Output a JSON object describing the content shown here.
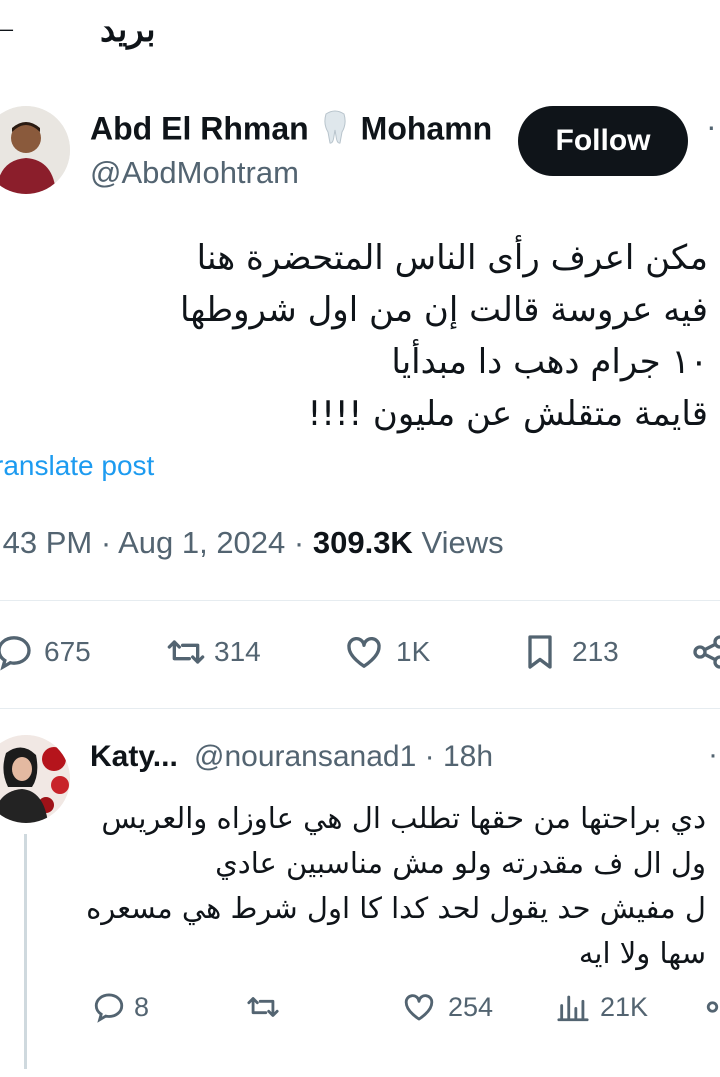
{
  "header": {
    "back_icon": "back-arrow-icon",
    "title": "بريد"
  },
  "tweet": {
    "author_name": "Abd El Rhman",
    "author_name_suffix": "Mohamn",
    "author_emoji": "tooth-icon",
    "handle": "@AbdMohtram",
    "follow_label": "Follow",
    "more_label": "·",
    "lines": [
      "مكن اعرف رأى الناس المتحضرة هنا",
      "فيه عروسة قالت إن من اول شروطها",
      "١٠ جرام دهب دا مبدأيا",
      "قايمة متقلش عن مليون !!!!"
    ],
    "translate_label": "ranslate post",
    "time": ":43 PM",
    "date": "Aug 1, 2024",
    "separator": "·",
    "views_count": "309.3K",
    "views_label": "Views",
    "replies": "675",
    "reposts": "314",
    "likes": "1K",
    "bookmarks": "213"
  },
  "reply": {
    "author_name": "Katy...",
    "handle": "@nouransanad1",
    "time": "· 18h",
    "more_label": "·",
    "lines": [
      "دي براحتها من حقها تطلب ال هي عاوزاه والعريس",
      "ول ال ف مقدرته ولو مش مناسبين عادي",
      "ل مفيش حد يقول لحد كدا كا اول شرط هي مسعره",
      "سها ولا ايه"
    ],
    "replies": "8",
    "likes": "254",
    "views": "21K"
  },
  "colors": {
    "accent": "#1d9bf0",
    "text": "#0f1419",
    "muted": "#536471",
    "border": "#e6ecf0"
  }
}
